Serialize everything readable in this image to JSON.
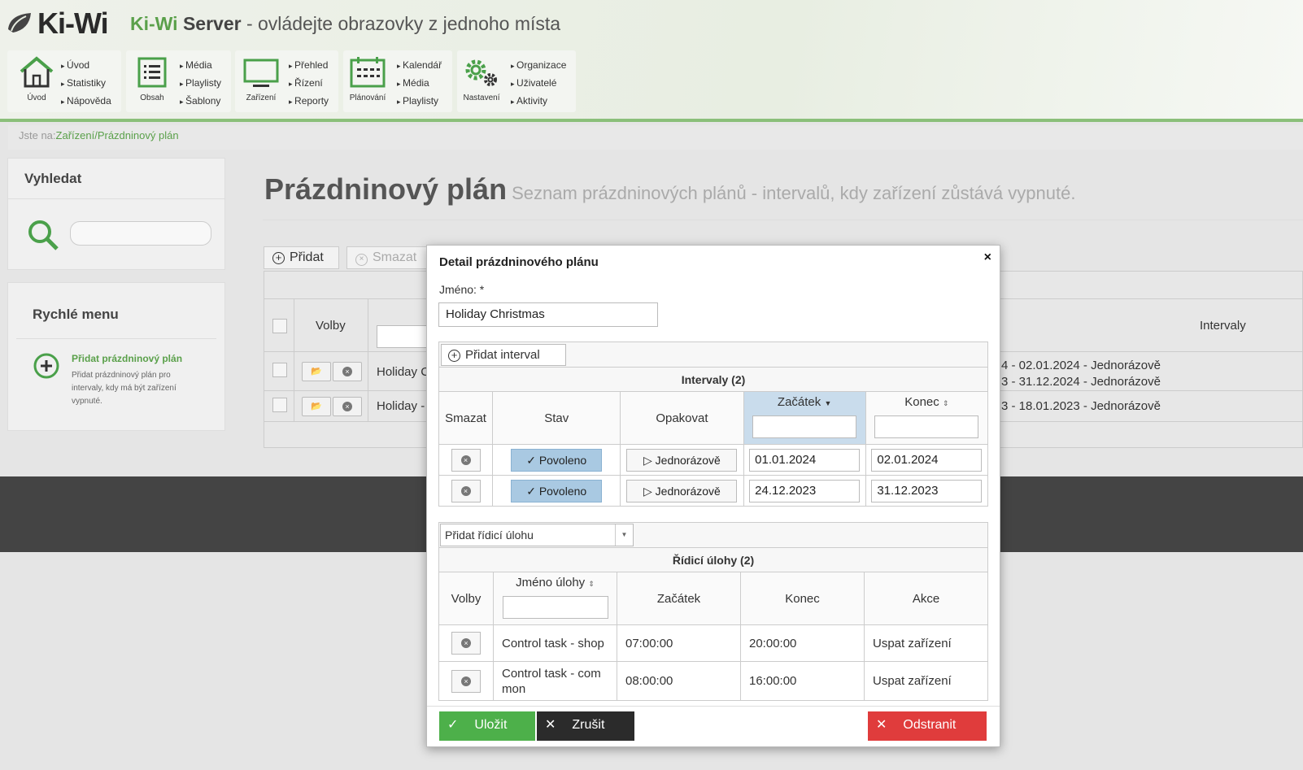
{
  "header": {
    "logo_text": "Ki-Wi",
    "tagline_brand": "Ki-Wi",
    "tagline_server": " Server",
    "tagline_rest": " - ovládejte obrazovky z jednoho místa"
  },
  "nav": [
    {
      "label": "Úvod",
      "links": [
        "Úvod",
        "Statistiky",
        "Nápověda"
      ]
    },
    {
      "label": "Obsah",
      "links": [
        "Média",
        "Playlisty",
        "Šablony"
      ]
    },
    {
      "label": "Zařízení",
      "links": [
        "Přehled",
        "Řízení",
        "Reporty"
      ]
    },
    {
      "label": "Plánování",
      "links": [
        "Kalendář",
        "Média",
        "Playlisty"
      ]
    },
    {
      "label": "Nastavení",
      "links": [
        "Organizace",
        "Uživatelé",
        "Aktivity"
      ]
    }
  ],
  "breadcrumb": {
    "prefix": "Jste na:",
    "path": "Zařízení/Prázdninový plán"
  },
  "search_panel": {
    "title": "Vyhledat"
  },
  "quick_menu": {
    "title": "Rychlé menu",
    "item_title": "Přidat prázdninový plán",
    "item_desc": "Přidat prázdninový plán pro intervaly, kdy má být zařízení vypnuté."
  },
  "page": {
    "title": "Prázdninový plán",
    "subtitle": "Seznam prázdninových plánů - intervalů, kdy zařízení zůstává vypnuté."
  },
  "toolbar": {
    "add": "Přidat",
    "delete": "Smazat"
  },
  "grid": {
    "col_options": "Volby",
    "col_intervals": "Intervaly",
    "rows": [
      {
        "name": "Holiday C",
        "intervals": [
          "4 - 02.01.2024 - Jednorázově",
          "3 - 31.12.2024 - Jednorázově"
        ]
      },
      {
        "name": "Holiday -",
        "intervals": [
          "3 - 18.01.2023 - Jednorázově"
        ]
      }
    ]
  },
  "modal": {
    "title": "Detail prázdninového plánu",
    "close": "×",
    "name_label": "Jméno: *",
    "name_value": "Holiday Christmas",
    "add_interval": "Přidat interval",
    "intervals_title": "Intervaly (2)",
    "interval_headers": {
      "delete": "Smazat",
      "state": "Stav",
      "repeat": "Opakovat",
      "start": "Začátek",
      "end": "Konec"
    },
    "intervals": [
      {
        "state": "Povoleno",
        "repeat": "Jednorázově",
        "start": "01.01.2024",
        "end": "02.01.2024"
      },
      {
        "state": "Povoleno",
        "repeat": "Jednorázově",
        "start": "24.12.2023",
        "end": "31.12.2023"
      }
    ],
    "task_select": "Přidat řídicí úlohu",
    "tasks_title": "Řídicí úlohy (2)",
    "task_headers": {
      "options": "Volby",
      "name": "Jméno úlohy",
      "start": "Začátek",
      "end": "Konec",
      "action": "Akce"
    },
    "tasks": [
      {
        "name": "Control task - shop",
        "start": "07:00:00",
        "end": "20:00:00",
        "action": "Uspat zařízení"
      },
      {
        "name": "Control task - com mon",
        "start": "08:00:00",
        "end": "16:00:00",
        "action": "Uspat zařízení"
      }
    ],
    "save": "Uložit",
    "cancel": "Zrušit",
    "remove": "Odstranit"
  },
  "colors": {
    "brand_green": "#5aa04a",
    "save": "#4db04a",
    "cancel": "#2b2b2b",
    "remove": "#e03c3c",
    "state": "#a9c9e2"
  }
}
